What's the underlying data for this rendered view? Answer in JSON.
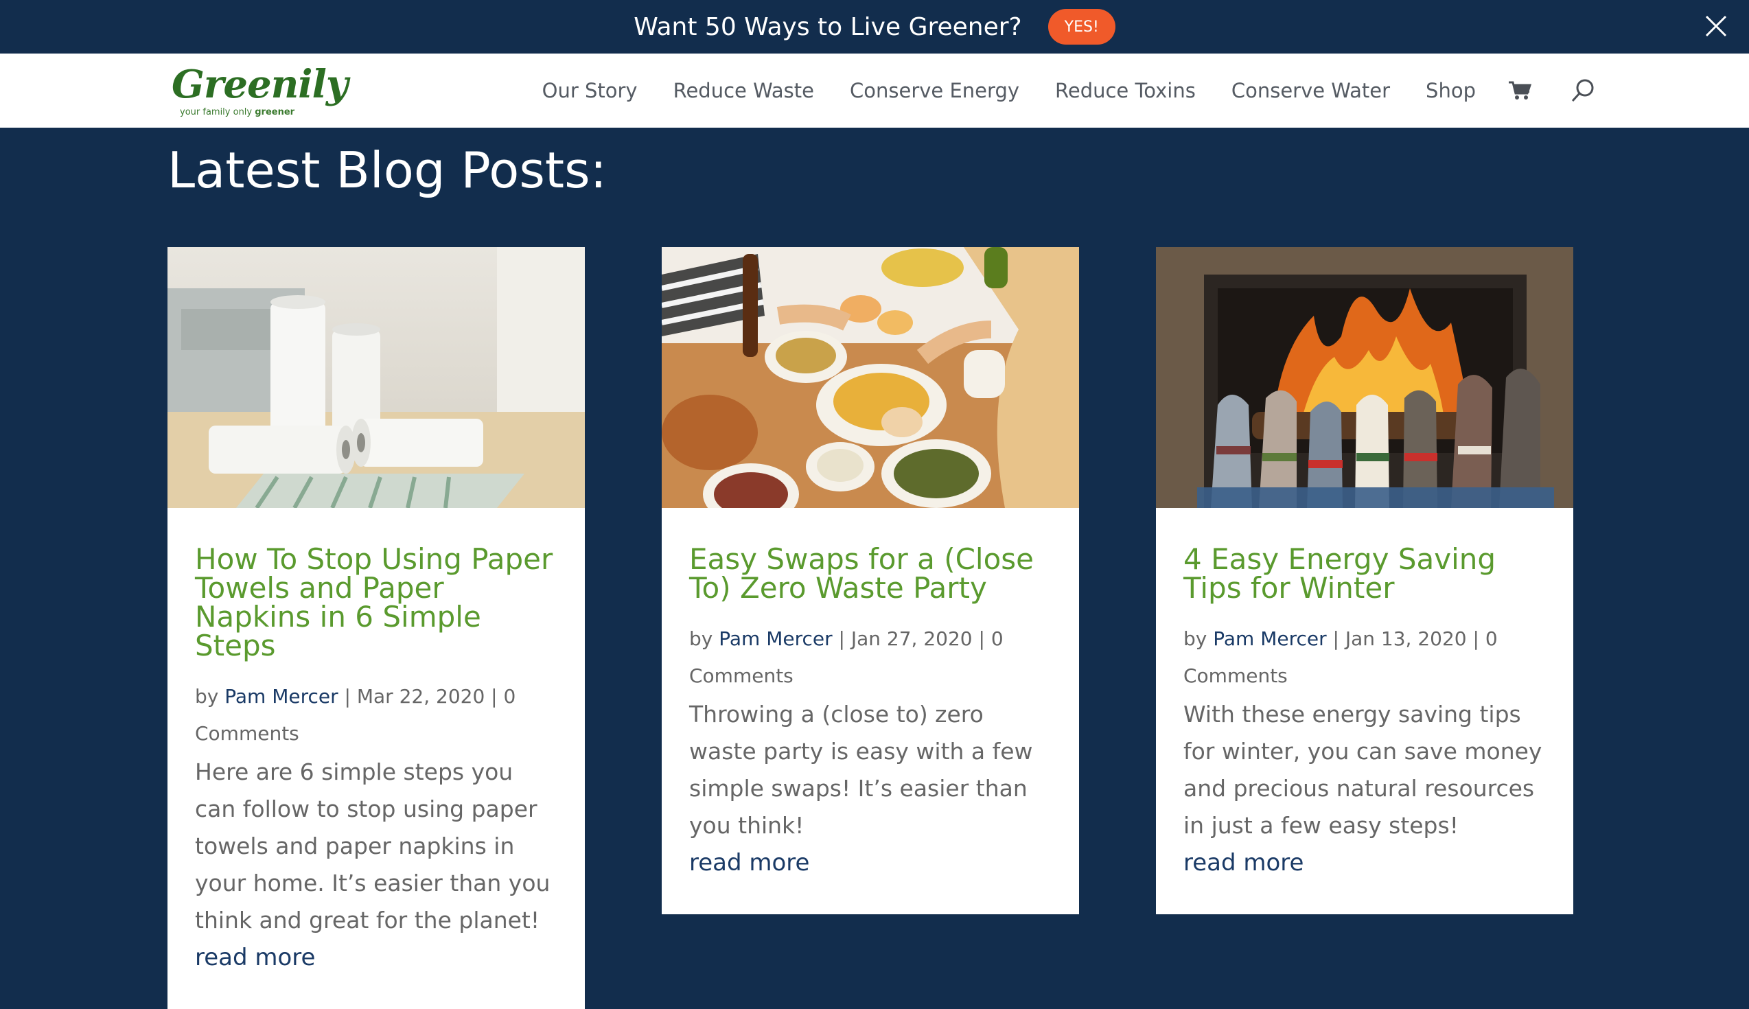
{
  "promo": {
    "text": "Want 50 Ways to Live Greener?",
    "button_label": "YES!",
    "close_icon": "close-icon"
  },
  "header": {
    "logo_text": "Greenily",
    "logo_tagline_prefix": "your family only ",
    "logo_tagline_bold": "greener",
    "nav": [
      {
        "label": "Our Story"
      },
      {
        "label": "Reduce Waste"
      },
      {
        "label": "Conserve Energy"
      },
      {
        "label": "Reduce Toxins"
      },
      {
        "label": "Conserve Water"
      },
      {
        "label": "Shop"
      }
    ],
    "cart_icon": "cart-icon",
    "search_icon": "search-icon"
  },
  "main": {
    "section_title": "Latest Blog Posts:",
    "posts": [
      {
        "title": "How To Stop Using Paper Towels and Paper Napkins in 6 Simple Steps",
        "by": "by ",
        "author": "Pam Mercer",
        "meta_rest": " | Mar 22, 2020 | 0 Comments",
        "excerpt": "Here are 6 simple steps you can follow to stop using paper towels and paper napkins in your home. It’s easier than you think and great for the planet!",
        "read_more": "read more"
      },
      {
        "title": "Easy Swaps for a (Close To) Zero Waste Party",
        "by": "by ",
        "author": "Pam Mercer",
        "meta_rest": " | Jan 27, 2020 | 0 Comments",
        "excerpt": "Throwing a (close to) zero waste party is easy with a few simple swaps! It’s easier than you think!",
        "read_more": "read more"
      },
      {
        "title": "4 Easy Energy Saving Tips for Winter",
        "by": "by ",
        "author": "Pam Mercer",
        "meta_rest": " | Jan 13, 2020 | 0 Comments",
        "excerpt": "With these energy saving tips for winter, you can save money and precious natural resources in just a few easy steps!",
        "read_more": "read more"
      }
    ]
  },
  "colors": {
    "background": "#122d4d",
    "accent_green": "#5a9a2e",
    "promo_button": "#f05a2a",
    "link_blue": "#1a3a66"
  }
}
